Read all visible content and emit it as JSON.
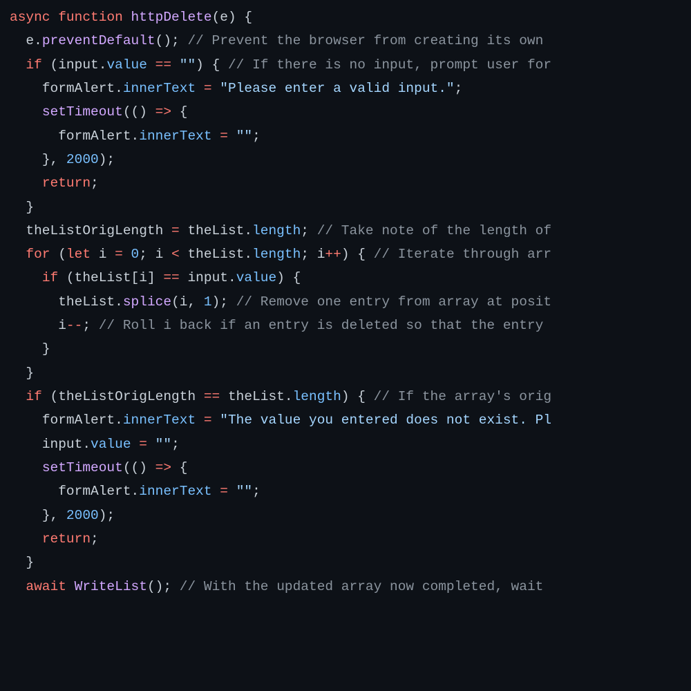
{
  "code": {
    "t": {
      "async": "async",
      "function": "function",
      "if": "if",
      "return": "return",
      "for": "for",
      "let": "let",
      "await": "await",
      "arrow": "=>"
    },
    "fn": {
      "httpDelete": "httpDelete",
      "preventDefault": "preventDefault",
      "setTimeout": "setTimeout",
      "splice": "splice",
      "WriteList": "WriteList"
    },
    "id": {
      "e": "e",
      "input": "input",
      "formAlert": "formAlert",
      "theList": "theList",
      "theListOrigLength": "theListOrigLength",
      "i": "i"
    },
    "prop": {
      "value": "value",
      "innerText": "innerText",
      "length": "length"
    },
    "str": {
      "empty": "\"\"",
      "pleaseEnter": "\"Please enter a valid input.\"",
      "notExist": "\"The value you entered does not exist. Pl"
    },
    "num": {
      "n2000": "2000",
      "n0": "0",
      "n1": "1"
    },
    "cm": {
      "c1": "// Prevent the browser from creating its own ",
      "c2": "// If there is no input, prompt user for",
      "c3": "// Take note of the length of",
      "c4": "// Iterate through arr",
      "c5": "// Remove one entry from array at posit",
      "c6": "// Roll i back if an entry is deleted so that the entry ",
      "c7": "// If the array's orig",
      "c8": "// With the updated array now completed, wait "
    },
    "p": {
      "openParen": "(",
      "closeParen": ")",
      "openBrace": "{",
      "closeBrace": "}",
      "openBracket": "[",
      "closeBracket": "]",
      "semi": ";",
      "comma": ",",
      "dot": ".",
      "space": " "
    },
    "op": {
      "eq": "=",
      "eqeq": "==",
      "lt": "<",
      "plusplus": "++",
      "minusminus": "--"
    }
  }
}
